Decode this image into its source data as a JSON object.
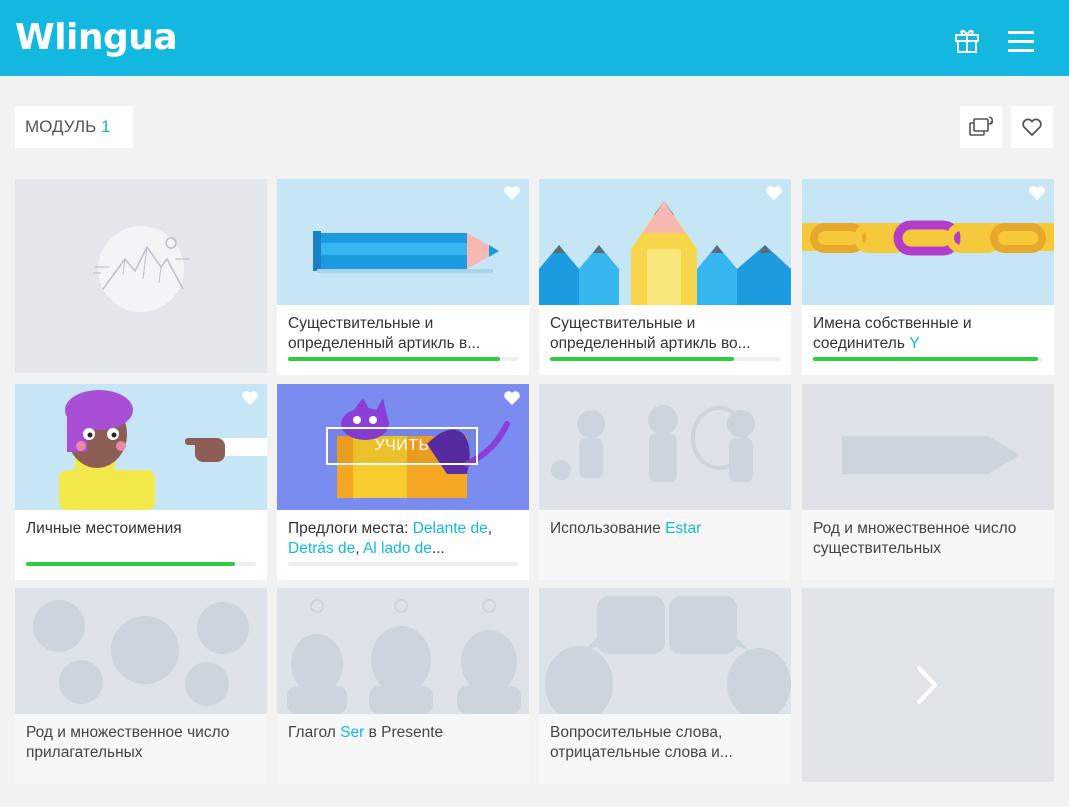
{
  "header": {
    "logo_text": "Wlingua",
    "icons": {
      "gift": "gift-icon",
      "menu": "hamburger-menu-icon"
    },
    "brand_color": "#12b8e0"
  },
  "module": {
    "label": "МОДУЛЬ",
    "number": "1",
    "icons": {
      "switch": "switch-view-icon",
      "favorite": "heart-outline-icon"
    }
  },
  "cards": [
    {
      "title_parts": [
        "Существительные и определенный артикль в..."
      ],
      "progress": 0.92,
      "state": "in-progress",
      "image": "pencil"
    },
    {
      "title_parts": [
        "Существительные и определенный артикль во..."
      ],
      "progress": 0.8,
      "state": "in-progress",
      "image": "pencils"
    },
    {
      "title_a": "Имена собственные и соединитель ",
      "title_hl": "Y",
      "progress": 0.98,
      "state": "in-progress",
      "image": "chain"
    },
    {
      "title": "Личные местоимения",
      "progress": 0.91,
      "state": "in-progress",
      "image": "person-pointing"
    },
    {
      "title_a": "Предлоги места: ",
      "hl1": "Delante de",
      "sep1": ",",
      "hl2": "Detrás de",
      "sep2": ", ",
      "hl3": "Al lado de",
      "tail": "...",
      "progress": 0.0,
      "state": "current",
      "button": "УЧИТЬ",
      "image": "cat-box"
    },
    {
      "title_a": "Использование ",
      "title_hl": "Estar",
      "state": "locked",
      "image": "people"
    },
    {
      "title": "Род и множественное число существительных",
      "state": "locked",
      "image": "arrow"
    },
    {
      "title": "Род и множественное число прилагательных",
      "state": "locked",
      "image": "circles"
    },
    {
      "title_a": "Глагол ",
      "title_hl": "Ser",
      "title_b": " в Presente",
      "state": "locked",
      "image": "heads"
    },
    {
      "title": "Вопросительные слова, отрицательные слова и...",
      "state": "locked",
      "image": "speech"
    }
  ],
  "next_icon": "chevron-right-icon",
  "placeholder_icon": "mountain-placeholder-icon",
  "colors": {
    "progress": "#2ecc40",
    "card_image_bg": "#c6e6f6",
    "locked_bg": "#e3e6ea"
  }
}
